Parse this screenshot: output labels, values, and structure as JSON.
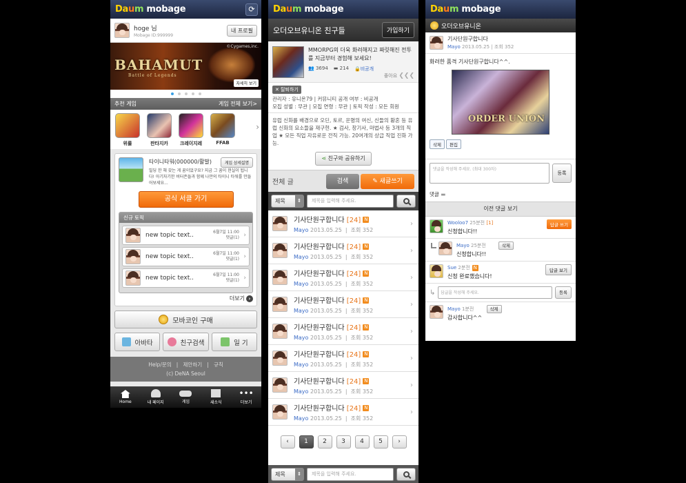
{
  "brand": {
    "part1": "Da",
    "part2": "u",
    "part3": "m",
    "rest": " mobage"
  },
  "screen1": {
    "user": {
      "name": "hoge 님",
      "id": "Mobage ID:999999",
      "profile_btn": "내 프로필"
    },
    "banner": {
      "title": "BAHAMUT",
      "subtitle": "Battle of Legends",
      "copyright": "©Cygames,inc.",
      "detail": "자세히 보기"
    },
    "rec_section": {
      "title": "추천 게임",
      "all": "게임 전체 보기>"
    },
    "games": [
      {
        "name": "위룰"
      },
      {
        "name": "판타지카"
      },
      {
        "name": "크레이지레"
      },
      {
        "name": "FFAB"
      }
    ],
    "promo": {
      "title": "타이니타워(000000/활발)",
      "guide": "게임 상세설명",
      "desc": "빌딩 한 채 갖는 게 꿈이었구요? 지금 그 꿈이 현실이 됩니다! 아기자기한 비터존들과 함께 나만의 타이니 타워를 만들어보세요...",
      "cta": "공식 서클 가기"
    },
    "topics": {
      "header": "신규 토픽",
      "items": [
        {
          "title": "new topic text..",
          "date": "6월7일 11:00",
          "replies": "댓글(1)"
        },
        {
          "title": "new topic text..",
          "date": "6월7일 11:00",
          "replies": "댓글(1)"
        },
        {
          "title": "new topic text..",
          "date": "6월7일 11:00",
          "replies": "댓글(1)"
        }
      ],
      "more": "더보기"
    },
    "coin_btn": "모바코인 구매",
    "buttons": {
      "avatar": "아바타",
      "friend": "친구검색",
      "diary": "일 기"
    },
    "footer": {
      "help": "Help/문의",
      "suggest": "제안하기",
      "terms": "규칙",
      "copyright": "(c) DeNA Seoul"
    },
    "tabs": [
      {
        "label": "Home"
      },
      {
        "label": "내 페이지"
      },
      {
        "label": "게임"
      },
      {
        "label": "새소식"
      },
      {
        "label": "더보기"
      }
    ]
  },
  "screen2": {
    "title": "오더오브유니온 친구들",
    "join": "가입하기",
    "desc": "MMORPG의 더욱 화려해지고 짜릿해진 전투를 지금부터 경험해 보세요!",
    "members": "3694",
    "posts": "214",
    "privacy": "비공개",
    "like": "좋아요",
    "report": "탈퇴하기",
    "meta1": "관리자 : 유니온79  |  커뮤니티 공개 여부 : 비공개",
    "meta2": "모집 성별 : 무관  |  모집 연령 : 무관  |  토픽 작성 : 모든 회원",
    "detail": "유럽 신화를 배경으로 오딘, 토르, 운명의 여신, 신들의 황혼 등 유럽 신화의 요소들을 재구현. ★ 검사, 창기사, 마법사 등 3개의 직업 ★ 모든 직업 자유로운 전직 가능. 20여개의 상급 직업 진화 가능.",
    "share": "친구와 공유하기",
    "list_title": "전체 글",
    "search_btn": "검색",
    "write_btn": "새글쓰기",
    "select": "제목",
    "placeholder": "제목을 입력해 주세요.",
    "posts_list": [
      {
        "title": "기사단원구합니다",
        "count": "[24]",
        "badge": "N",
        "author": "Mayo",
        "date": "2013.05.25",
        "views": "조회 352"
      },
      {
        "title": "기사단원구합니다",
        "count": "[24]",
        "badge": "N",
        "author": "Mayo",
        "date": "2013.05.25",
        "views": "조회 352"
      },
      {
        "title": "기사단원구합니다",
        "count": "[24]",
        "badge": "N",
        "author": "Mayo",
        "date": "2013.05.25",
        "views": "조회 352"
      },
      {
        "title": "기사단원구합니다",
        "count": "[24]",
        "badge": "N",
        "author": "Mayo",
        "date": "2013.05.25",
        "views": "조회 352"
      },
      {
        "title": "기사단원구합니다",
        "count": "[24]",
        "badge": "N",
        "author": "Mayo",
        "date": "2013.05.25",
        "views": "조회 352"
      },
      {
        "title": "기사단원구합니다",
        "count": "[24]",
        "badge": "N",
        "author": "Mayo",
        "date": "2013.05.25",
        "views": "조회 352"
      },
      {
        "title": "기사단원구합니다",
        "count": "[24]",
        "badge": "N",
        "author": "Mayo",
        "date": "2013.05.25",
        "views": "조회 352"
      },
      {
        "title": "기사단원구합니다",
        "count": "[24]",
        "badge": "N",
        "author": "Mayo",
        "date": "2013.05.25",
        "views": "조회 352"
      }
    ],
    "pages": [
      "1",
      "2",
      "3",
      "4",
      "5"
    ],
    "prev": "‹",
    "next": "›"
  },
  "screen3": {
    "community": "오더오브유니온",
    "post_title": "기사단원구합니다",
    "author": "Mayo",
    "date": "2013.05.25",
    "views": "조회 352",
    "body": "화려한 품격 기사단원구합니다^^.",
    "art_text": "ORDER UNION",
    "delete": "삭제",
    "edit": "편집",
    "comment_placeholder": "댓글을 작성해 주세요. (최대 300자)",
    "register": "등록",
    "comment_label": "댓글",
    "prev_comments": "이전 댓글 보기",
    "comments": [
      {
        "author": "Wooloo7",
        "time": "25분전",
        "count": "[1]",
        "text": "신청합니다!!",
        "action": "답글 쓰기"
      },
      {
        "author": "Mayo",
        "time": "25분전",
        "text": "신청합니다!!",
        "action": "삭제"
      },
      {
        "author": "Sue",
        "time": "2분전",
        "text": "신청 완료했습니다!",
        "action": "답글 보기"
      },
      {
        "author": "Mayo",
        "time": "1분전",
        "text": "감사합니다^^",
        "action": "삭제"
      }
    ],
    "reply_placeholder": "답글을 작성해 주세요.",
    "reply_register": "등록"
  }
}
